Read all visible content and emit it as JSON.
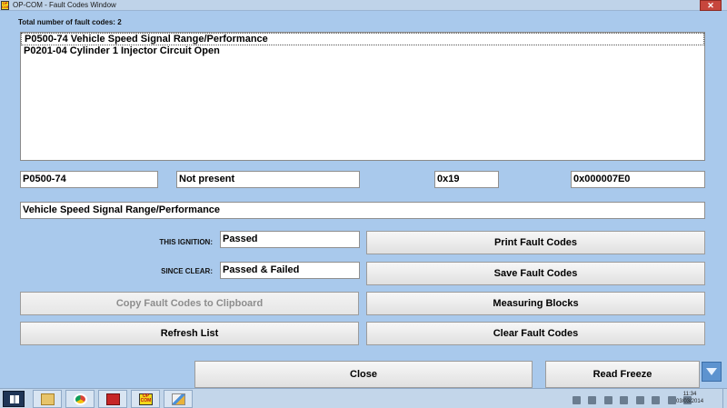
{
  "window": {
    "title": "OP-COM - Fault Codes Window",
    "app_icon_text": "OP COM",
    "close_glyph": "✕"
  },
  "fault_count_label": "Total number of fault codes:  2",
  "fault_codes": [
    {
      "text": "P0500-74 Vehicle Speed Signal Range/Performance",
      "selected": true
    },
    {
      "text": "P0201-04 Cylinder 1 Injector Circuit Open",
      "selected": false
    }
  ],
  "details": {
    "code": "P0500-74",
    "status": "Not present",
    "hex_value": "0x19",
    "ecu_id": "0x000007E0",
    "description": "Vehicle Speed Signal Range/Performance"
  },
  "this_ignition": {
    "label": "THIS IGNITION:",
    "value": "Passed"
  },
  "since_clear": {
    "label": "SINCE CLEAR:",
    "value": "Passed & Failed"
  },
  "buttons": {
    "copy": "Copy Fault Codes to Clipboard",
    "refresh": "Refresh List",
    "print": "Print Fault Codes",
    "save": "Save Fault Codes",
    "measuring": "Measuring Blocks",
    "clear": "Clear Fault Codes",
    "close": "Close",
    "read_freeze": "Read Freeze"
  },
  "taskbar": {
    "icons": [
      "start-icon",
      "file-explorer-icon",
      "chrome-icon",
      "toolbox-icon",
      "opcom-icon",
      "paint-icon"
    ],
    "opcom_text": "OP COM",
    "time": "11:34",
    "date": "03/03/2014"
  },
  "colors": {
    "window_bg": "#a9c9ec",
    "close_red": "#c7463c",
    "taskbar_bg": "#c3d6ea"
  }
}
